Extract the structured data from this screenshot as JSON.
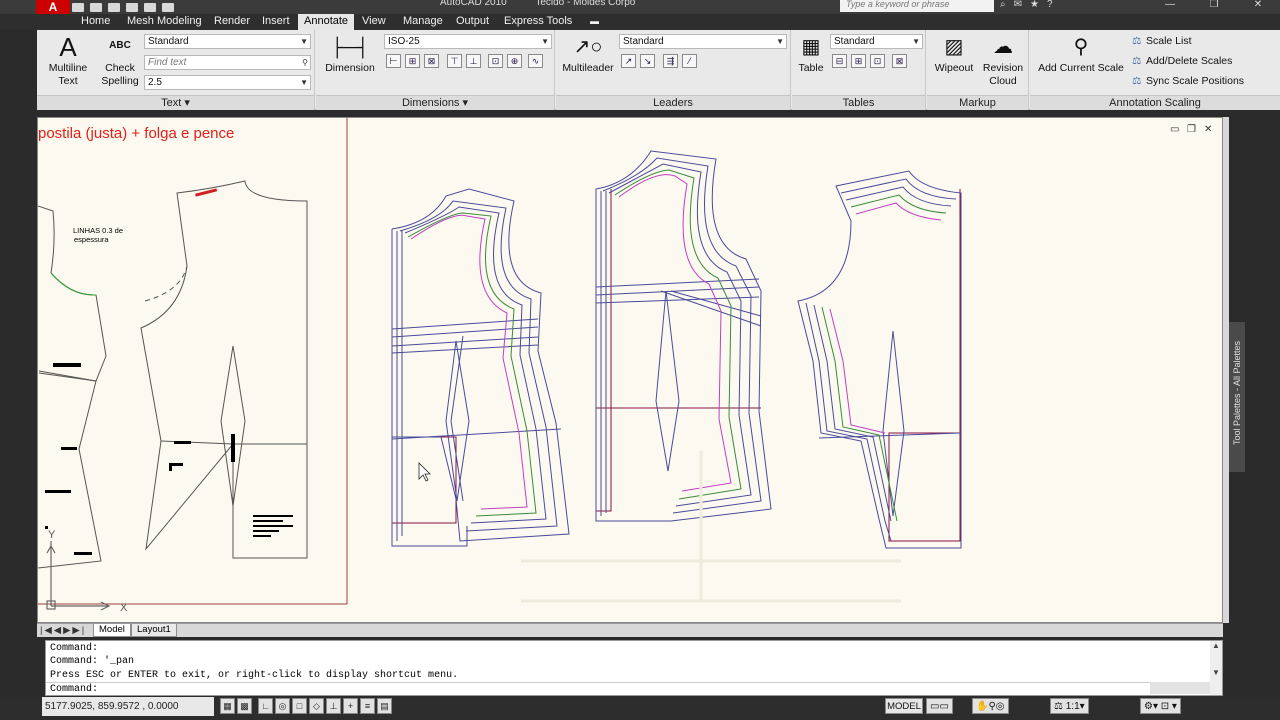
{
  "app": {
    "logo": "A",
    "title": "AutoCAD 2010",
    "document": "Tecido - Moldes Corpo",
    "search_placeholder": "Type a keyword or phrase",
    "win_min": "—",
    "win_max": "❐",
    "win_close": "✕"
  },
  "tabs": [
    "Home",
    "Mesh Modeling",
    "Render",
    "Insert",
    "Annotate",
    "View",
    "Manage",
    "Output",
    "Express Tools"
  ],
  "active_tab": "Annotate",
  "ribbon": {
    "text_panel": {
      "title": "Text",
      "multiline_label": "Multiline\nText",
      "check_label": "Check\nSpelling",
      "check_icon": "ABC",
      "style_value": "Standard",
      "find_placeholder": "Find text",
      "height_value": "2.5"
    },
    "dimensions_panel": {
      "title": "Dimensions",
      "dimension_label": "Dimension",
      "style_value": "ISO-25"
    },
    "leaders_panel": {
      "title": "Leaders",
      "multileader_label": "Multileader",
      "style_value": "Standard"
    },
    "tables_panel": {
      "title": "Tables",
      "table_label": "Table",
      "style_value": "Standard"
    },
    "markup_panel": {
      "title": "Markup",
      "wipeout_label": "Wipeout",
      "revision_label": "Revision\nCloud"
    },
    "scaling_panel": {
      "title": "Annotation Scaling",
      "add_scale_label": "Add Current Scale",
      "scale_list": "Scale List",
      "add_delete": "Add/Delete Scales",
      "sync": "Sync Scale Positions"
    }
  },
  "drawing": {
    "heading": "postila (justa) + folga e pence",
    "note_line1": "LINHAS 0.3 de",
    "note_line2": "espessura",
    "axis_y": "Y",
    "axis_x": "X"
  },
  "side_palette": "Tool Palettes - All Palettes",
  "layout_tabs": [
    "Model",
    "Layout1"
  ],
  "command_lines": [
    "Command:",
    "Command: '_pan",
    "Press ESC or ENTER to exit, or right-click to display shortcut menu."
  ],
  "command_prompt": "Command:",
  "status": {
    "coords": "5177.9025, 859.9572 , 0.0000",
    "model": "MODEL",
    "scale": "1:1"
  }
}
